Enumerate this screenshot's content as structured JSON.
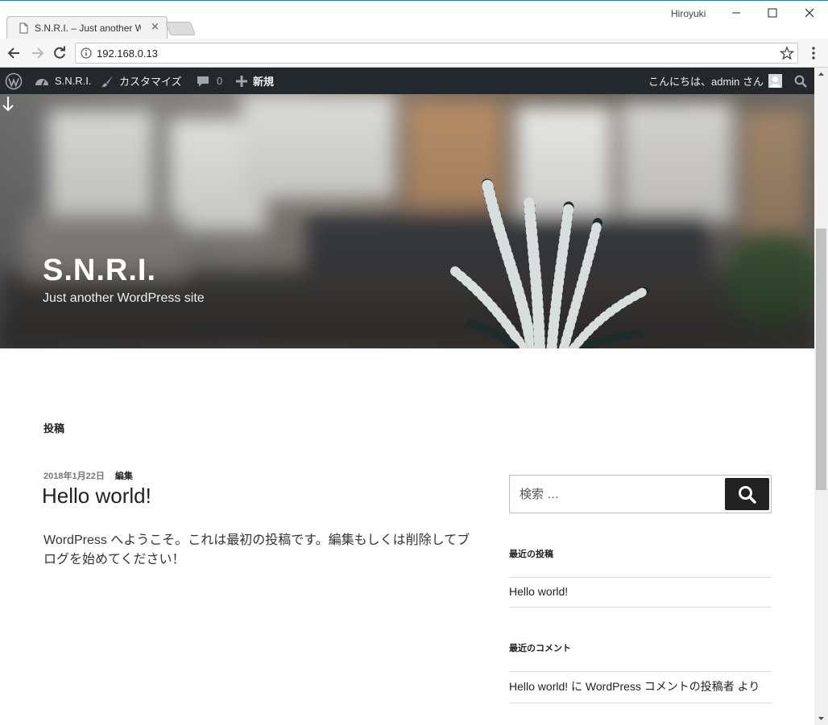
{
  "browser": {
    "tab_title": "S.N.R.I. – Just another WordPress site",
    "tab_close": "×",
    "profile_name": "Hiroyuki",
    "url": "192.168.0.13"
  },
  "adminbar": {
    "site_name": "S.N.R.I.",
    "customize": "カスタマイズ",
    "comments_count": "0",
    "new_label": "新規",
    "greeting": "こんにちは、admin さん"
  },
  "header": {
    "site_title": "S.N.R.I.",
    "site_description": "Just another WordPress site"
  },
  "content": {
    "page_heading": "投稿",
    "post": {
      "date": "2018年1月22日",
      "edit_label": "編集",
      "title": "Hello world!",
      "body": "WordPress へようこそ。これは最初の投稿です。編集もしくは削除してブログを始めてください！"
    }
  },
  "sidebar": {
    "search_placeholder": "検索 …",
    "recent_posts_title": "最近の投稿",
    "recent_posts": [
      "Hello world!"
    ],
    "recent_comments_title": "最近のコメント",
    "recent_comments": [
      "Hello world! に WordPress コメントの投稿者 より"
    ]
  },
  "colors": {
    "adminbar_bg": "#23282d",
    "accent_blue": "#2a7ec9",
    "search_button_bg": "#222222"
  }
}
